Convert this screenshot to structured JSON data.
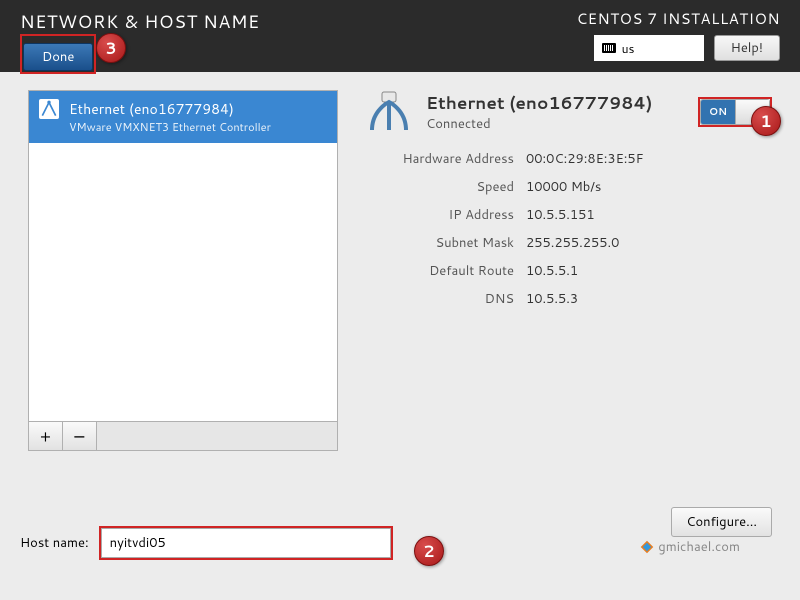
{
  "header": {
    "title": "NETWORK & HOST NAME",
    "install_title": "CENTOS 7 INSTALLATION",
    "kbd_layout": "us",
    "help_label": "Help!",
    "done_label": "Done"
  },
  "interfaces": {
    "items": [
      {
        "name": "Ethernet (eno16777984)",
        "sub": "VMware VMXNET3 Ethernet Controller",
        "selected": true
      }
    ],
    "add_label": "+",
    "remove_label": "−"
  },
  "detail": {
    "title": "Ethernet (eno16777984)",
    "status": "Connected",
    "toggle_on_label": "ON",
    "props": [
      {
        "label": "Hardware Address",
        "value": "00:0C:29:8E:3E:5F"
      },
      {
        "label": "Speed",
        "value": "10000 Mb/s"
      },
      {
        "label": "IP Address",
        "value": "10.5.5.151"
      },
      {
        "label": "Subnet Mask",
        "value": "255.255.255.0"
      },
      {
        "label": "Default Route",
        "value": "10.5.5.1"
      },
      {
        "label": "DNS",
        "value": "10.5.5.3"
      }
    ],
    "configure_label": "Configure..."
  },
  "hostname": {
    "label": "Host name:",
    "value": "nyitvdi05"
  },
  "watermark": "gmichael.com",
  "callouts": {
    "c1": "1",
    "c2": "2",
    "c3": "3"
  }
}
